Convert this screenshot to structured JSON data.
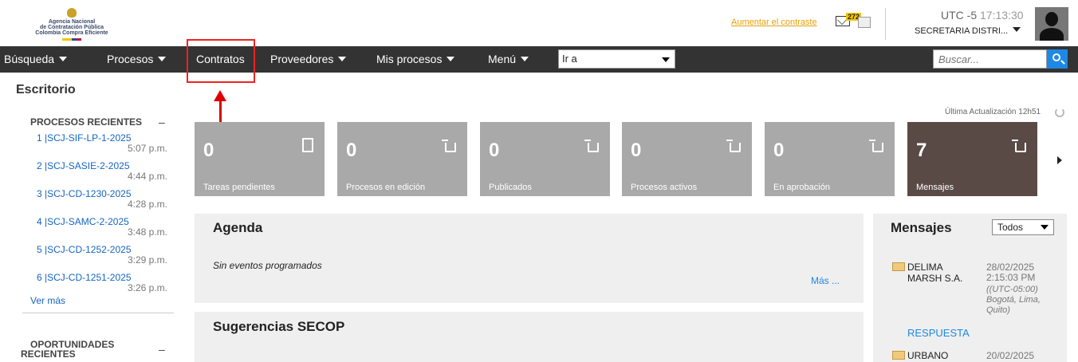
{
  "header": {
    "logo_lines": [
      "Agencia Nacional",
      "de Contratación Pública",
      "Colombia Compra Eficiente"
    ],
    "contrast_link": "Aumentar el contraste",
    "mail_count": "272",
    "timezone": "UTC -5",
    "time": "17:13:30",
    "entity": "SECRETARIA DISTRI..."
  },
  "nav": {
    "items": [
      "Búsqueda",
      "Procesos",
      "Contratos",
      "Proveedores",
      "Mis procesos",
      "Menú"
    ],
    "goto_value": "Ir a",
    "search_placeholder": "Buscar..."
  },
  "sidebar": {
    "title": "Escritorio",
    "recent_header": "PROCESOS RECIENTES",
    "collapse_symbol": "–",
    "recent": [
      {
        "code": "1 |SCJ-SIF-LP-1-2025",
        "time": "5:07 p.m."
      },
      {
        "code": "2 |SCJ-SASIE-2-2025",
        "time": "4:44 p.m."
      },
      {
        "code": "3 |SCJ-CD-1230-2025",
        "time": "4:28 p.m."
      },
      {
        "code": "4 |SCJ-SAMC-2-2025",
        "time": "3:48 p.m."
      },
      {
        "code": "5 |SCJ-CD-1252-2025",
        "time": "3:29 p.m."
      },
      {
        "code": "6 |SCJ-CD-1251-2025",
        "time": "3:26 p.m."
      }
    ],
    "more": "Ver más",
    "opportunities_header_1": "OPORTUNIDADES",
    "opportunities_header_2": "RECIENTES"
  },
  "dashboard": {
    "last_update": "Última Actualización 12h51",
    "tiles": [
      {
        "count": "0",
        "label": "Tareas pendientes",
        "icon": "clipboard-check-icon"
      },
      {
        "count": "0",
        "label": "Procesos en edición",
        "icon": "cart-icon"
      },
      {
        "count": "0",
        "label": "Publicados",
        "icon": "cart-icon"
      },
      {
        "count": "0",
        "label": "Procesos activos",
        "icon": "cart-icon"
      },
      {
        "count": "0",
        "label": "En aprobación",
        "icon": "cart-icon"
      },
      {
        "count": "7",
        "label": "Mensajes",
        "icon": "cart-icon"
      }
    ]
  },
  "agenda": {
    "title": "Agenda",
    "empty": "Sin eventos programados",
    "more": "Más ..."
  },
  "suggestions": {
    "title": "Sugerencias SECOP"
  },
  "messages": {
    "title": "Mensajes",
    "filter": "Todos",
    "items": [
      {
        "sender_1": "DELIMA",
        "sender_2": "MARSH S.A.",
        "date": "28/02/2025",
        "time": "2:15:03 PM",
        "zone_1": "((UTC-05:00)",
        "zone_2": "Bogotá, Lima,",
        "zone_3": "Quito)",
        "action": "RESPUESTA"
      },
      {
        "sender_1": "URBANO",
        "date": "20/02/2025"
      }
    ]
  },
  "colors": {
    "nav_bg": "#333333",
    "tile_bg": "#a9a9a9",
    "tile_active": "#5a4a45",
    "link": "#1565c0",
    "highlight": "#e22222"
  }
}
